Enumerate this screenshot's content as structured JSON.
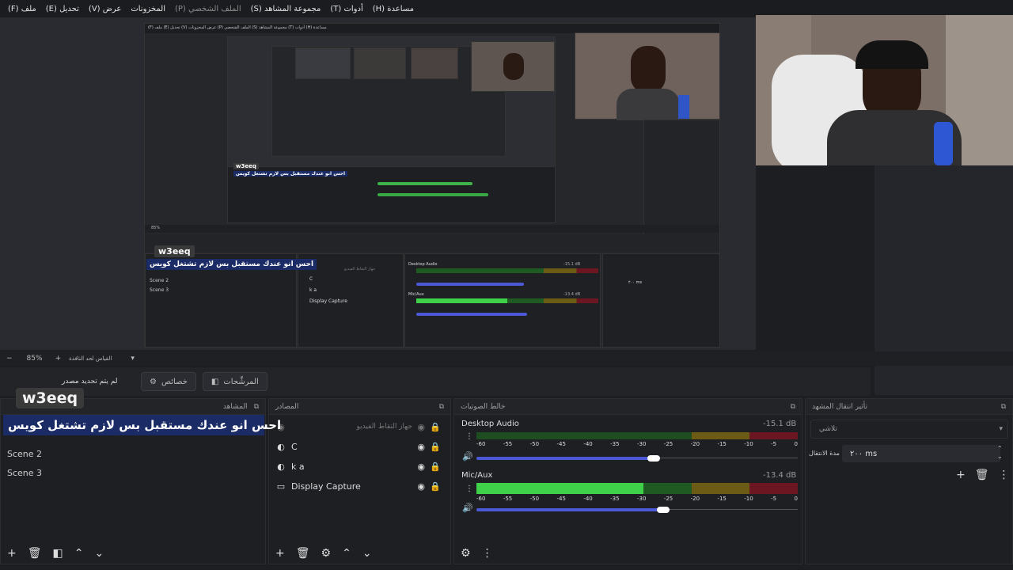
{
  "menu": [
    "(F) ملف",
    "(E) تحديل",
    "(V) عرض",
    "المخزونات",
    "(P) الملف الشخصي",
    "(S) مجموعة المشاهد",
    "(T) أدوات",
    "(H) مساعدة"
  ],
  "menu_dim_index": 4,
  "zoom": {
    "value": "85%",
    "minus": "−",
    "plus": "+",
    "label": "القياس لحد النافذة"
  },
  "source_toolbar": {
    "no_source": "لم يتم تحديد مصدر",
    "properties": "خصائص",
    "filters": "المرشِّحات"
  },
  "overlay": {
    "channel": "w3eeq",
    "caption": "احس انو عندك مستقبل بس لازم تشتغل كويس"
  },
  "scenes": {
    "title": "المشاهد",
    "items": [
      "Scene 2",
      "Scene 3"
    ]
  },
  "sources": {
    "title": "المصادر",
    "items": [
      {
        "icon": "camera-icon",
        "glyph": "◉",
        "label": "جهاز التقاط الفيديو",
        "disabled": true
      },
      {
        "icon": "browser-icon",
        "glyph": "◐",
        "label": "C"
      },
      {
        "icon": "browser-icon",
        "glyph": "◐",
        "label": "k a"
      },
      {
        "icon": "monitor-icon",
        "glyph": "▭",
        "label": "Display Capture"
      }
    ]
  },
  "mixer": {
    "title": "خالط الصوتيات",
    "channels": [
      {
        "name": "Desktop Audio",
        "db": "-15.1 dB",
        "level": 0.0,
        "volume": 0.88
      },
      {
        "name": "Mic/Aux",
        "db": "-13.4 dB",
        "level": 0.52,
        "volume": 0.92
      }
    ],
    "ticks": [
      "-60",
      "-55",
      "-50",
      "-45",
      "-40",
      "-35",
      "-30",
      "-25",
      "-20",
      "-15",
      "-10",
      "-5",
      "0"
    ]
  },
  "transitions": {
    "title": "تأثير انتقال المشهد",
    "type": "تلاشي",
    "duration_label": "مدة الانتقال",
    "duration": "٢٠٠ ms"
  },
  "nested": {
    "channel": "w3eeq",
    "caption": "احس انو عندك مستقبل بس لازم تشتغل كويس",
    "scene2": "Scene 2",
    "scene3": "Scene 3",
    "src_c": "C",
    "src_ka": "k a",
    "src_dc": "Display Capture",
    "src_cam": "جهاز التقاط الفيديو",
    "zoom": "85%",
    "desk": "Desktop Audio",
    "mic": "Mic/Aux",
    "desk_db": "-15.1 dB",
    "mic_db": "-13.4 dB",
    "dur": "٢٠٠ ms"
  }
}
